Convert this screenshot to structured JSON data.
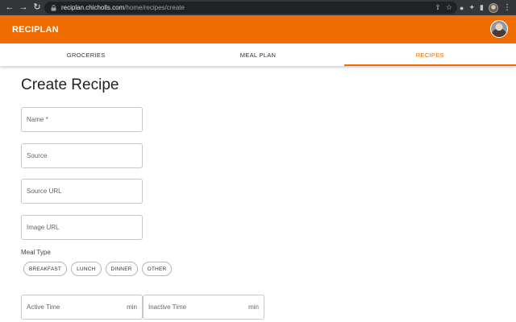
{
  "browser": {
    "back_icon": "arrow-left-icon",
    "forward_icon": "arrow-right-icon",
    "reload_icon": "reload-icon",
    "url_host": "reciplan.chicholls.com",
    "url_path": "/home/recipes/create"
  },
  "app": {
    "title": "RECIPLAN",
    "accent_color": "#ef6c00"
  },
  "tabs": [
    {
      "label": "GROCERIES",
      "active": false
    },
    {
      "label": "MEAL PLAN",
      "active": false
    },
    {
      "label": "RECIPES",
      "active": true
    }
  ],
  "form": {
    "title": "Create Recipe",
    "name_placeholder": "Name *",
    "source_placeholder": "Source",
    "source_url_placeholder": "Source URL",
    "image_url_placeholder": "Image URL",
    "meal_type_label": "Meal Type",
    "meal_types": [
      "BREAKFAST",
      "LUNCH",
      "DINNER",
      "OTHER"
    ],
    "active_time_placeholder": "Active Time",
    "active_time_unit": "min",
    "inactive_time_placeholder": "Inactive Time",
    "inactive_time_unit": "min"
  }
}
